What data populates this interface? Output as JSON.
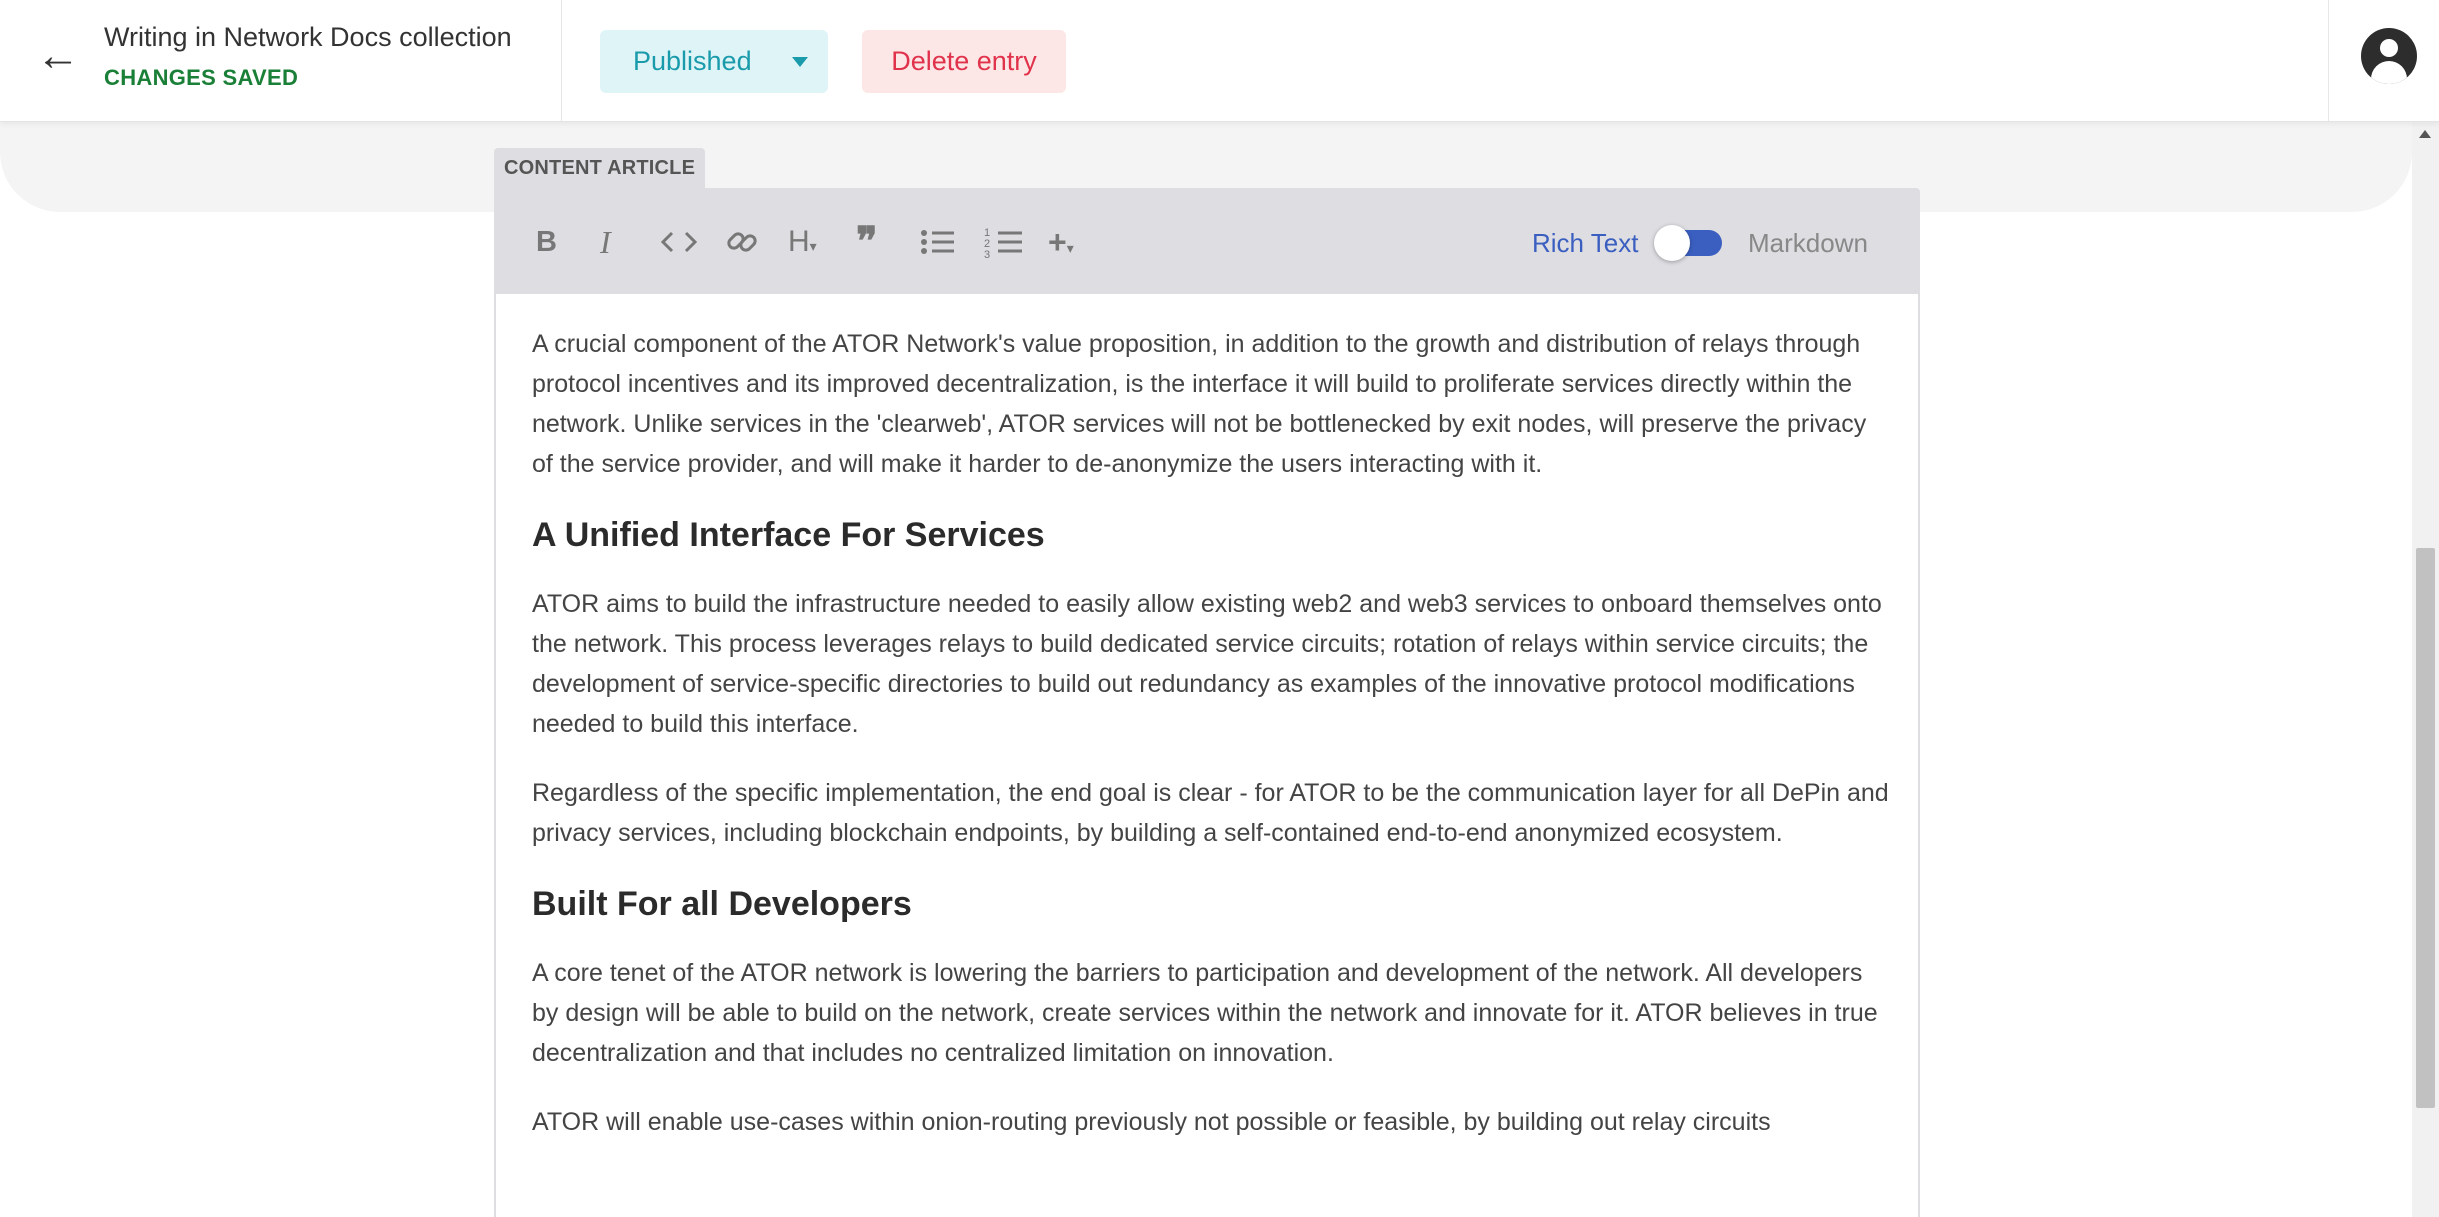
{
  "header": {
    "title": "Writing in Network Docs collection",
    "status": "CHANGES SAVED",
    "publish_label": "Published",
    "delete_label": "Delete entry"
  },
  "editor": {
    "label": "CONTENT ARTICLE",
    "toolbar": {
      "rich_text_label": "Rich Text",
      "markdown_label": "Markdown",
      "tools": [
        "bold",
        "italic",
        "code",
        "link",
        "heading",
        "quote",
        "bulleted-list",
        "numbered-list",
        "add"
      ]
    },
    "content": [
      {
        "type": "p",
        "text": "A crucial component of the ATOR Network's value proposition, in addition to the growth and distribution of relays through protocol incentives and its improved decentralization, is the interface it will build to proliferate services directly within the network. Unlike services in the 'clearweb', ATOR services will not be bottlenecked by exit nodes, will preserve the privacy of the service provider, and will make it harder to de-anonymize the users interacting with it."
      },
      {
        "type": "h2",
        "text": "A Unified Interface For Services"
      },
      {
        "type": "p",
        "text": "ATOR aims to build the infrastructure needed to easily allow existing web2 and web3 services to onboard themselves onto the network. This process leverages relays to build dedicated service circuits; rotation of relays within service circuits; the development of service-specific directories to build out redundancy as examples of the innovative protocol modifications needed to build this interface."
      },
      {
        "type": "p",
        "text": "Regardless of the specific implementation, the end goal is clear - for ATOR to be the communication layer for all DePin and privacy services, including blockchain endpoints, by building a self-contained end-to-end anonymized ecosystem."
      },
      {
        "type": "h2",
        "text": "Built For all Developers"
      },
      {
        "type": "p",
        "text": "A core tenet of the ATOR network is lowering the barriers to participation and development of the network. All developers by design will be able to build on the network, create services within the network and innovate for it. ATOR believes in true decentralization and that includes no centralized limitation on innovation."
      },
      {
        "type": "p",
        "text": "ATOR will enable use-cases within onion-routing previously not possible or feasible, by building out relay circuits"
      }
    ]
  }
}
